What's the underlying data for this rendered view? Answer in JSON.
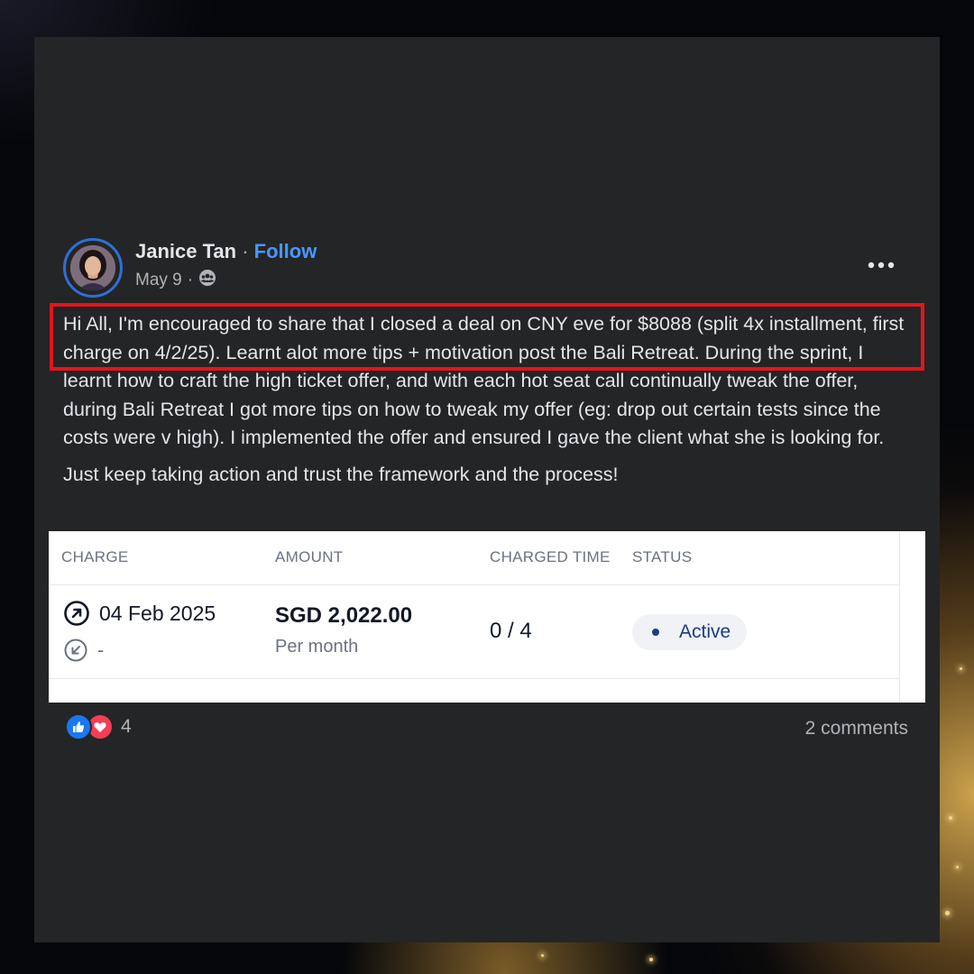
{
  "post": {
    "author": "Janice Tan",
    "separator": "·",
    "follow_label": "Follow",
    "date": "May 9",
    "date_separator": "·",
    "audience_icon": "group-icon",
    "more_icon": "more-horizontal-icon",
    "paragraphs": [
      "Hi All, I'm encouraged to share that I closed a deal on CNY eve for $8088 (split 4x installment, first charge on 4/2/25). Learnt alot more tips + motivation post the Bali Retreat. During the sprint, I learnt how to craft the high ticket offer, and with each hot seat call continually tweak the offer, during Bali Retreat I got more tips on how to tweak my offer (eg: drop out certain tests since the costs were v high). I implemented the offer and ensured I gave the client what she is looking for.",
      "Just keep taking action and trust the framework and the process!"
    ],
    "highlight_color": "#e3141c"
  },
  "charge_table": {
    "headers": {
      "charge": "CHARGE",
      "amount": "AMOUNT",
      "charged_time": "CHARGED TIME",
      "status": "STATUS"
    },
    "row": {
      "charge_date": "04 Feb 2025",
      "charge_date_icon": "arrow-up-right-circle-icon",
      "refund": "-",
      "refund_icon": "arrow-down-left-circle-icon",
      "amount": "SGD 2,022.00",
      "frequency": "Per month",
      "charged_time": "0 / 4",
      "status": "Active"
    }
  },
  "footer": {
    "reaction_icons": [
      "like-icon",
      "love-icon"
    ],
    "reaction_count": "4",
    "comments": "2 comments"
  },
  "colors": {
    "card_bg": "#242526",
    "primary_text": "#e4e6eb",
    "secondary_text": "#b0b3b8",
    "follow_link": "#4599ff",
    "status_text": "#1e3a8a"
  }
}
